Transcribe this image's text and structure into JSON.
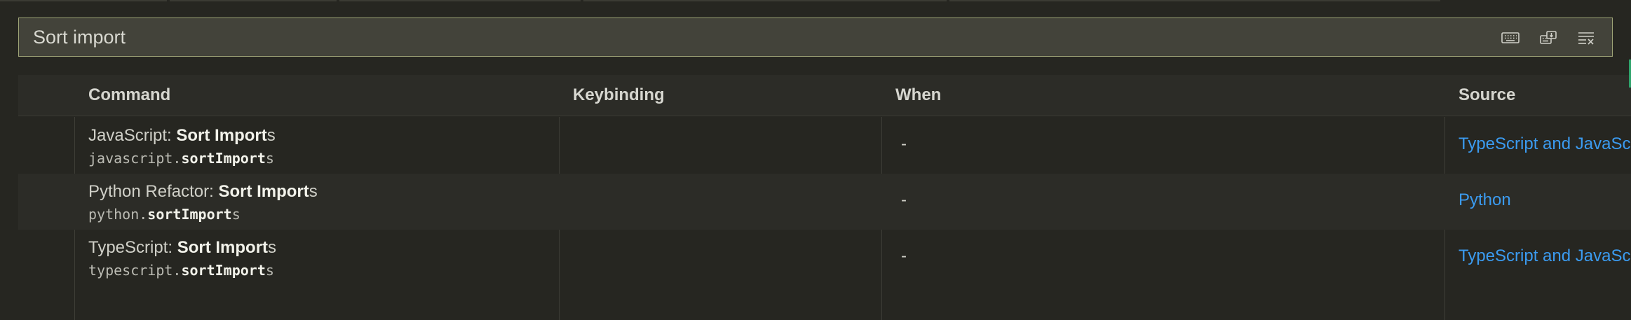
{
  "search": {
    "value": "Sort import",
    "actions": [
      {
        "icon": "keyboard-icon"
      },
      {
        "icon": "record-keys-icon"
      },
      {
        "icon": "clear-list-icon"
      }
    ]
  },
  "table": {
    "columns": {
      "command": "Command",
      "keybinding": "Keybinding",
      "when": "When",
      "source": "Source"
    },
    "rows": [
      {
        "title_prefix": "JavaScript: ",
        "title_match": "Sort Import",
        "title_suffix": "s",
        "id_prefix": "javascript.",
        "id_match": "sortImport",
        "id_suffix": "s",
        "keybinding": "",
        "when": "-",
        "source": "TypeScript and JavaScript"
      },
      {
        "title_prefix": "Python Refactor: ",
        "title_match": "Sort Import",
        "title_suffix": "s",
        "id_prefix": "python.",
        "id_match": "sortImport",
        "id_suffix": "s",
        "keybinding": "",
        "when": "-",
        "source": "Python"
      },
      {
        "title_prefix": "TypeScript: ",
        "title_match": "Sort Import",
        "title_suffix": "s",
        "id_prefix": "typescript.",
        "id_match": "sortImport",
        "id_suffix": "s",
        "keybinding": "",
        "when": "-",
        "source": "TypeScript and JavaScript"
      }
    ]
  },
  "colors": {
    "background": "#262621",
    "search_border": "#9ea477",
    "link": "#3b9bf0",
    "accent": "#2ea36b"
  }
}
